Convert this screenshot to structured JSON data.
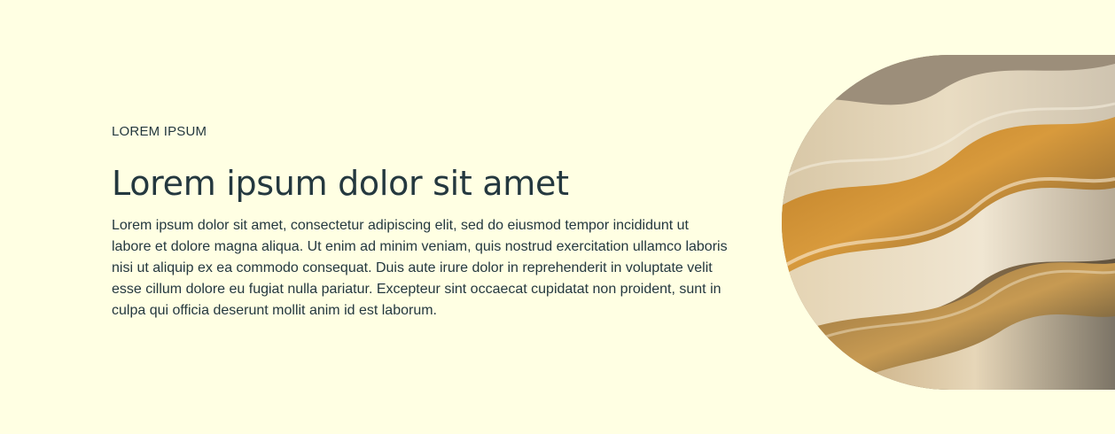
{
  "hero": {
    "eyebrow": "LOREM IPSUM",
    "title": "Lorem ipsum dolor sit amet",
    "body": "Lorem ipsum dolor sit amet, consectetur adipiscing elit, sed do eiusmod tempor incididunt ut labore et dolore magna aliqua. Ut enim ad minim veniam, quis nostrud exercitation ullamco laboris nisi ut aliquip ex ea commodo consequat. Duis aute irure dolor in reprehenderit in voluptate velit esse cillum dolore eu fugiat nulla pariatur. Excepteur sint occaecat cupidatat non proident, sunt in culpa qui officia deserunt mollit anim id est laborum."
  },
  "colors": {
    "background": "#FFFFE3",
    "text": "#24383F"
  },
  "image": {
    "semantic": "abstract-wavy-sand-image"
  }
}
